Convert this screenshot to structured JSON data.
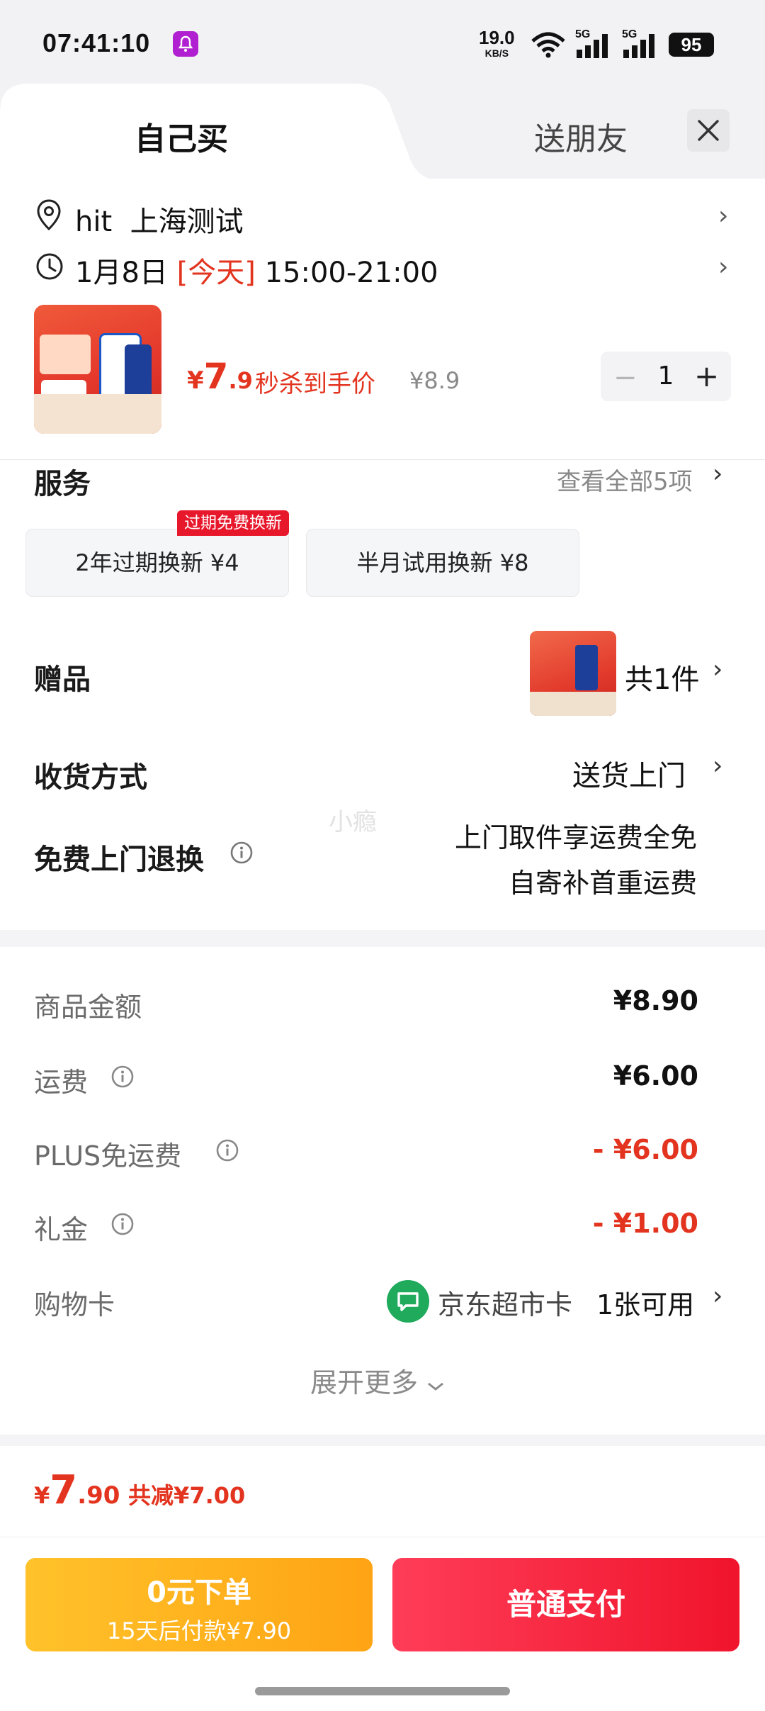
{
  "status_bar": {
    "time": "07:41:10",
    "net_speed": "19.0",
    "net_speed_unit": "KB/S",
    "battery": "95",
    "signal_1": "5G",
    "signal_2": "5G"
  },
  "header": {
    "tab_self": "自己买",
    "tab_gift": "送朋友"
  },
  "address": {
    "name": "hit",
    "location": "上海测试"
  },
  "delivery_time": {
    "date": "1月8日",
    "today": "[今天]",
    "slot": "15:00-21:00"
  },
  "product": {
    "price_symbol": "¥",
    "price_int": "7",
    "price_dec": ".9",
    "promo_label": "秒杀到手价",
    "orig_price": "¥8.9",
    "quantity": "1"
  },
  "services": {
    "title": "服务",
    "view_all": "查看全部5项",
    "badge": "过期免费换新",
    "options": [
      "2年过期换新  ¥4",
      "半月试用换新  ¥8"
    ]
  },
  "gift": {
    "title": "赠品",
    "count": "共1件"
  },
  "receive_method": {
    "title": "收货方式",
    "value": "送货上门"
  },
  "watermark": "小瘾",
  "free_return": {
    "title": "免费上门退换",
    "line1": "上门取件享运费全免",
    "line2": "自寄补首重运费"
  },
  "costs": {
    "goods_label": "商品金额",
    "goods_value": "¥8.90",
    "shipping_label": "运费",
    "shipping_value": "¥6.00",
    "plus_label": "PLUS免运费",
    "plus_value": "- ¥6.00",
    "coupon_label": "礼金",
    "coupon_value": "- ¥1.00",
    "card_label": "购物卡",
    "card_name": "京东超市卡",
    "card_available": "1张可用",
    "expand": "展开更多"
  },
  "total": {
    "symbol": "¥",
    "int": "7",
    "dec": ".90",
    "saved": "共减¥7.00"
  },
  "buttons": {
    "pay_later_title": "0元下单",
    "pay_later_sub": "15天后付款¥7.90",
    "pay_now": "普通支付"
  },
  "colors": {
    "accent_red": "#e3341f",
    "pay_later": "#ffb020",
    "pay_now": "#f0142c",
    "jd_card_green": "#1faa5c"
  }
}
